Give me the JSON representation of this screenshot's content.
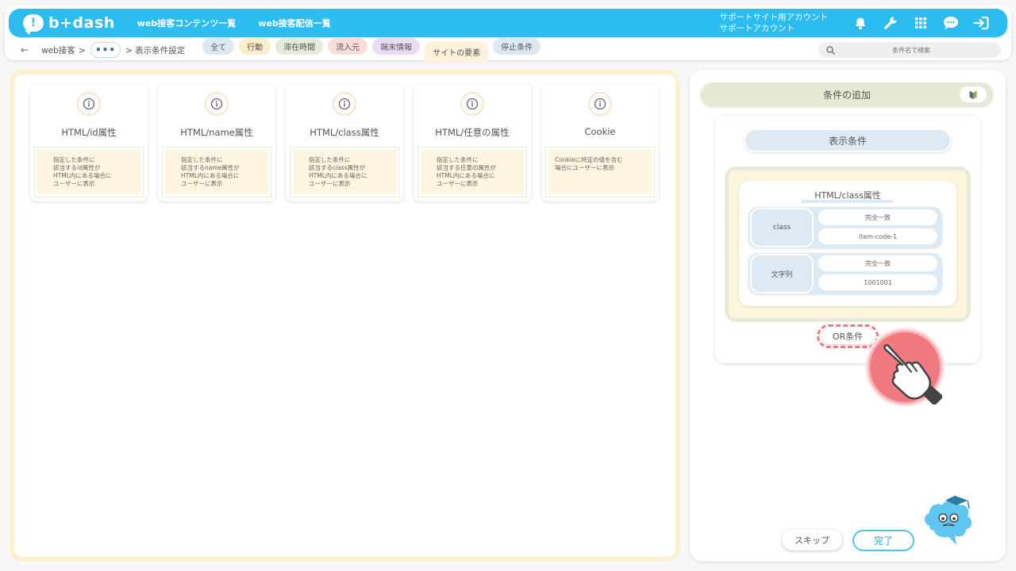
{
  "header": {
    "logo_text": "b+dash",
    "logo_mark": "!",
    "nav": [
      "web接客コンテンツ一覧",
      "web接客配信一覧"
    ],
    "account_line1": "サポートサイト用アカウント",
    "account_line2": "サポートアカウント",
    "icons": [
      "bell-icon",
      "wrench-icon",
      "grid-icon",
      "chat-icon",
      "logout-icon"
    ]
  },
  "breadcrumb": {
    "back": "←",
    "item1": "web接客",
    "sep": ">",
    "dots": "•••",
    "current": "> 表示条件設定"
  },
  "tabs": {
    "all": "全て",
    "action": "行動",
    "stay": "滞在時間",
    "source": "流入元",
    "device": "端末情報",
    "site": "サイトの要素",
    "stop": "停止条件"
  },
  "search": {
    "placeholder": "条件名で検索"
  },
  "cards": [
    {
      "title": "HTML/id属性",
      "desc": "指定した条件に\n該当するid属性が\nHTML内にある場合に\nユーザーに表示"
    },
    {
      "title": "HTML/name属性",
      "desc": "指定した条件に\n該当するname属性が\nHTML内にある場合に\nユーザーに表示"
    },
    {
      "title": "HTML/class属性",
      "desc": "指定した条件に\n該当するclass属性が\nHTML内にある場合に\nユーザーに表示"
    },
    {
      "title": "HTML/任意の属性",
      "desc": "指定した条件に\n該当する任意の属性が\nHTML内にある場合に\nユーザーに表示"
    },
    {
      "title": "Cookie",
      "desc": "Cookieに特定の値を含む\n場合にユーザーに表示"
    }
  ],
  "right": {
    "add_condition": "条件の追加",
    "display_condition": "表示条件",
    "condition_title": "HTML/class属性",
    "rows": [
      {
        "key": "class",
        "match": "完全一致",
        "value": "item-code-1"
      },
      {
        "key": "文字列",
        "match": "完全一致",
        "value": "1001001"
      }
    ],
    "or_button": "OR条件",
    "skip": "スキップ",
    "done": "完了"
  },
  "colors": {
    "brand": "#2bbdf0",
    "accent_red": "#f07a80"
  }
}
